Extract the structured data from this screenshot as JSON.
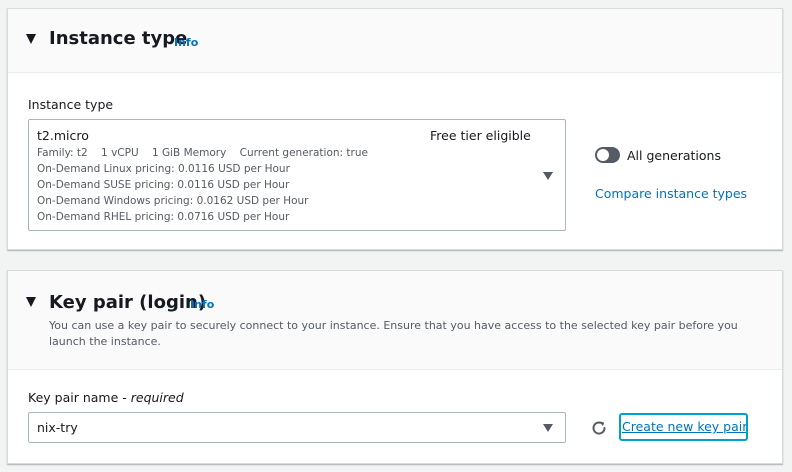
{
  "instance_type_section": {
    "title": "Instance type",
    "info": "Info",
    "field_label": "Instance type",
    "selected": {
      "name": "t2.micro",
      "badge": "Free tier eligible",
      "family_line": "Family: t2    1 vCPU    1 GiB Memory    Current generation: true",
      "pricing": [
        "On-Demand Linux pricing: 0.0116 USD per Hour",
        "On-Demand SUSE pricing: 0.0116 USD per Hour",
        "On-Demand Windows pricing: 0.0162 USD per Hour",
        "On-Demand RHEL pricing: 0.0716 USD per Hour"
      ]
    },
    "toggle_label": "All generations",
    "toggle_on": false,
    "compare_link": "Compare instance types"
  },
  "key_pair_section": {
    "title": "Key pair (login)",
    "info": "Info",
    "description": "You can use a key pair to securely connect to your instance. Ensure that you have access to the selected key pair before you launch the instance.",
    "field_label": "Key pair name - ",
    "field_label_required": "required",
    "selected_value": "nix-try",
    "create_link": "Create new key pair"
  },
  "colors": {
    "link": "#0073bb",
    "focus_ring": "#00a1c9",
    "toggle_off": "#545b64"
  },
  "icons": [
    "caret-down-icon",
    "dropdown-arrow-icon",
    "refresh-icon"
  ]
}
